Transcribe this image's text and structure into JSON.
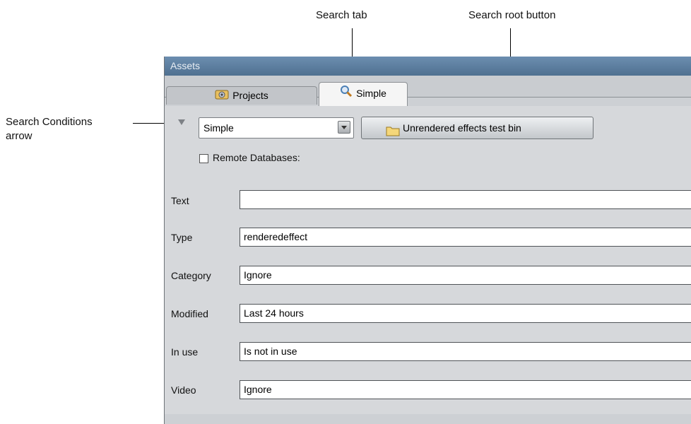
{
  "callouts": {
    "search_tab": "Search tab",
    "search_root_button": "Search root button",
    "search_conditions_line1": "Search Conditions",
    "search_conditions_line2": "arrow"
  },
  "window": {
    "title": "Assets"
  },
  "tabs": [
    {
      "label": "Projects",
      "icon": "projects-icon",
      "active": false
    },
    {
      "label": "Simple",
      "icon": "search-icon",
      "active": true
    }
  ],
  "search_type": {
    "selected": "Simple"
  },
  "root_button": {
    "label": "Unrendered effects test bin",
    "icon": "folder-icon"
  },
  "remote_databases": {
    "label": "Remote Databases:",
    "checked": false
  },
  "fields": [
    {
      "label": "Text",
      "value": ""
    },
    {
      "label": "Type",
      "value": "renderedeffect"
    },
    {
      "label": "Category",
      "value": "Ignore"
    },
    {
      "label": "Modified",
      "value": "Last 24 hours"
    },
    {
      "label": "In use",
      "value": "Is not in use"
    },
    {
      "label": "Video",
      "value": "Ignore"
    }
  ],
  "colors": {
    "titlebar": "#5b7c9d",
    "panel_bg": "#cdd0d4",
    "active_tab": "#f5f5f5"
  }
}
